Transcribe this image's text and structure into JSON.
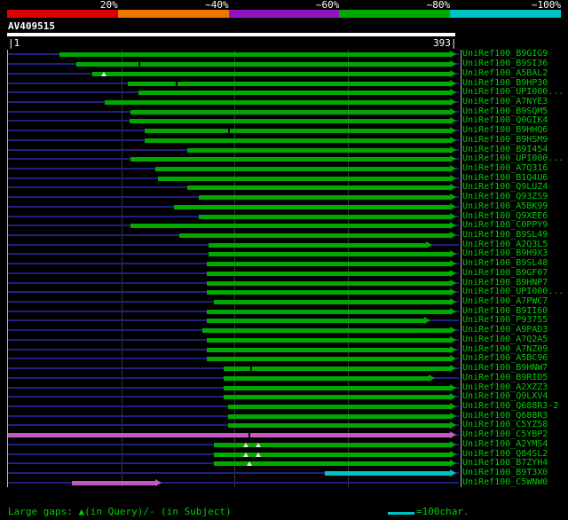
{
  "chart_data": {
    "type": "bar",
    "subtype": "blast-alignment-overview",
    "orientation": "horizontal",
    "identity_scale": {
      "tick_labels": [
        "20%",
        "~40%",
        "~60%",
        "~80%",
        "~100%"
      ],
      "segment_colors": [
        "#dd0000",
        "#ee7700",
        "#8f13bf",
        "#00a800",
        "#00c2c2"
      ]
    },
    "query": {
      "name": "AV409515",
      "ruler_left": "|1",
      "ruler_right": "393|",
      "length": 393
    },
    "bar_colors": {
      "green": "#00a800",
      "magenta": "#c05ac0",
      "cyan": "#00c2c2"
    },
    "track_color": "#202080",
    "alignments": [
      {
        "label": "UniRef100_B9GIG9",
        "start": 47,
        "end": 393,
        "color": "green"
      },
      {
        "label": "UniRef100_B9SI36",
        "start": 62,
        "end": 393,
        "color": "green",
        "marks": [
          {
            "pos": 117,
            "type": "dash"
          }
        ]
      },
      {
        "label": "UniRef100_A5BAL2",
        "start": 76,
        "end": 393,
        "color": "green",
        "marks": [
          {
            "pos": 86,
            "type": "tri"
          }
        ]
      },
      {
        "label": "UniRef100_B9HP30",
        "start": 107,
        "end": 393,
        "color": "green",
        "marks": [
          {
            "pos": 150,
            "type": "dash"
          }
        ]
      },
      {
        "label": "UniRef100_UPI000...",
        "start": 117,
        "end": 393,
        "color": "green"
      },
      {
        "label": "UniRef100_A7NYE3",
        "start": 87,
        "end": 393,
        "color": "green"
      },
      {
        "label": "UniRef100_B9SQM5",
        "start": 110,
        "end": 393,
        "color": "green"
      },
      {
        "label": "UniRef100_Q0GIK4",
        "start": 109,
        "end": 393,
        "color": "green"
      },
      {
        "label": "UniRef100_B9HHQ6",
        "start": 122,
        "end": 393,
        "color": "green",
        "marks": [
          {
            "pos": 196,
            "type": "dash"
          }
        ]
      },
      {
        "label": "UniRef100_B9HSM9",
        "start": 122,
        "end": 393,
        "color": "green"
      },
      {
        "label": "UniRef100_B9I454",
        "start": 160,
        "end": 393,
        "color": "green"
      },
      {
        "label": "UniRef100_UPI000...",
        "start": 110,
        "end": 393,
        "color": "green"
      },
      {
        "label": "UniRef100_A7Q316",
        "start": 132,
        "end": 393,
        "color": "green"
      },
      {
        "label": "UniRef100_B1Q4U6",
        "start": 134,
        "end": 393,
        "color": "green"
      },
      {
        "label": "UniRef100_Q9LUZ4",
        "start": 160,
        "end": 393,
        "color": "green"
      },
      {
        "label": "UniRef100_Q93ZS9",
        "start": 170,
        "end": 393,
        "color": "green"
      },
      {
        "label": "UniRef100_A5BK99",
        "start": 148,
        "end": 393,
        "color": "green"
      },
      {
        "label": "UniRef100_Q9XEE6",
        "start": 170,
        "end": 393,
        "color": "green"
      },
      {
        "label": "UniRef100_C0PPY9",
        "start": 110,
        "end": 393,
        "color": "green"
      },
      {
        "label": "UniRef100_B9SL49",
        "start": 153,
        "end": 393,
        "color": "green"
      },
      {
        "label": "UniRef100_A2Q3L5",
        "start": 179,
        "end": 372,
        "color": "green"
      },
      {
        "label": "UniRef100_B9H9X3",
        "start": 179,
        "end": 393,
        "color": "green"
      },
      {
        "label": "UniRef100_B9SL48",
        "start": 177,
        "end": 393,
        "color": "green"
      },
      {
        "label": "UniRef100_B9GF07",
        "start": 177,
        "end": 393,
        "color": "green"
      },
      {
        "label": "UniRef100_B9HNP7",
        "start": 177,
        "end": 393,
        "color": "green"
      },
      {
        "label": "UniRef100_UPI000...",
        "start": 177,
        "end": 393,
        "color": "green"
      },
      {
        "label": "UniRef100_A7PWC7",
        "start": 184,
        "end": 393,
        "color": "green"
      },
      {
        "label": "UniRef100_B9II60",
        "start": 177,
        "end": 393,
        "color": "green"
      },
      {
        "label": "UniRef100_P93755",
        "start": 177,
        "end": 370,
        "color": "green"
      },
      {
        "label": "UniRef100_A9PAD3",
        "start": 173,
        "end": 393,
        "color": "green"
      },
      {
        "label": "UniRef100_A7Q2A5",
        "start": 177,
        "end": 393,
        "color": "green"
      },
      {
        "label": "UniRef100_A7NZ09",
        "start": 177,
        "end": 393,
        "color": "green"
      },
      {
        "label": "UniRef100_A5BC96",
        "start": 177,
        "end": 393,
        "color": "green"
      },
      {
        "label": "UniRef100_B9HNW7",
        "start": 192,
        "end": 393,
        "color": "green",
        "marks": [
          {
            "pos": 216,
            "type": "dash"
          }
        ]
      },
      {
        "label": "UniRef100_B9RID5",
        "start": 192,
        "end": 374,
        "color": "green"
      },
      {
        "label": "UniRef100_A2XZZ3",
        "start": 192,
        "end": 393,
        "color": "green"
      },
      {
        "label": "UniRef100_Q9LXV4",
        "start": 192,
        "end": 393,
        "color": "green"
      },
      {
        "label": "UniRef100_Q688R3-2",
        "start": 196,
        "end": 393,
        "color": "green"
      },
      {
        "label": "UniRef100_Q688R3",
        "start": 196,
        "end": 393,
        "color": "green"
      },
      {
        "label": "UniRef100_C5YZ58",
        "start": 196,
        "end": 393,
        "color": "green"
      },
      {
        "label": "UniRef100_C5YBP2",
        "start": 1,
        "end": 393,
        "color": "magenta",
        "marks": [
          {
            "pos": 214,
            "type": "dash"
          }
        ]
      },
      {
        "label": "UniRef100_A2YMS4",
        "start": 184,
        "end": 393,
        "color": "green",
        "marks": [
          {
            "pos": 212,
            "type": "tri"
          },
          {
            "pos": 223,
            "type": "tri"
          }
        ]
      },
      {
        "label": "UniRef100_Q84SL2",
        "start": 184,
        "end": 393,
        "color": "green",
        "marks": [
          {
            "pos": 212,
            "type": "tri"
          },
          {
            "pos": 223,
            "type": "tri"
          }
        ]
      },
      {
        "label": "UniRef100_B7ZYH4",
        "start": 184,
        "end": 393,
        "color": "green",
        "marks": [
          {
            "pos": 215,
            "type": "tri"
          }
        ]
      },
      {
        "label": "UniRef100_B9T3X0",
        "start": 282,
        "end": 393,
        "color": "cyan"
      },
      {
        "label": "UniRef100_C5WNW0",
        "start": 58,
        "end": 132,
        "color": "magenta"
      }
    ],
    "footer": {
      "gap_legend": "Large gaps: ▲(in Query)/- (in Subject)",
      "scale_legend": "=100char."
    }
  }
}
